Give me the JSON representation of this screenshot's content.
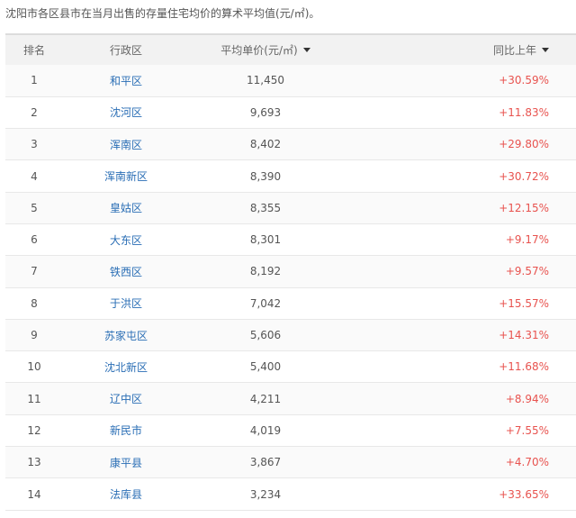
{
  "caption": "沈阳市各区县市在当月出售的存量住宅均价的算术平均值(元/㎡)。",
  "headers": {
    "rank": "排名",
    "district": "行政区",
    "price": "平均单价(元/㎡)",
    "change": "同比上年"
  },
  "rows": [
    {
      "rank": "1",
      "district": "和平区",
      "price": "11,450",
      "change": "+30.59%"
    },
    {
      "rank": "2",
      "district": "沈河区",
      "price": "9,693",
      "change": "+11.83%"
    },
    {
      "rank": "3",
      "district": "浑南区",
      "price": "8,402",
      "change": "+29.80%"
    },
    {
      "rank": "4",
      "district": "浑南新区",
      "price": "8,390",
      "change": "+30.72%"
    },
    {
      "rank": "5",
      "district": "皇姑区",
      "price": "8,355",
      "change": "+12.15%"
    },
    {
      "rank": "6",
      "district": "大东区",
      "price": "8,301",
      "change": "+9.17%"
    },
    {
      "rank": "7",
      "district": "铁西区",
      "price": "8,192",
      "change": "+9.57%"
    },
    {
      "rank": "8",
      "district": "于洪区",
      "price": "7,042",
      "change": "+15.57%"
    },
    {
      "rank": "9",
      "district": "苏家屯区",
      "price": "5,606",
      "change": "+14.31%"
    },
    {
      "rank": "10",
      "district": "沈北新区",
      "price": "5,400",
      "change": "+11.68%"
    },
    {
      "rank": "11",
      "district": "辽中区",
      "price": "4,211",
      "change": "+8.94%"
    },
    {
      "rank": "12",
      "district": "新民市",
      "price": "4,019",
      "change": "+7.55%"
    },
    {
      "rank": "13",
      "district": "康平县",
      "price": "3,867",
      "change": "+4.70%"
    },
    {
      "rank": "14",
      "district": "法库县",
      "price": "3,234",
      "change": "+33.65%"
    }
  ],
  "colors": {
    "link": "#2a6eb5",
    "positive_change": "#e8534f",
    "header_bg": "#f2f2f2"
  }
}
